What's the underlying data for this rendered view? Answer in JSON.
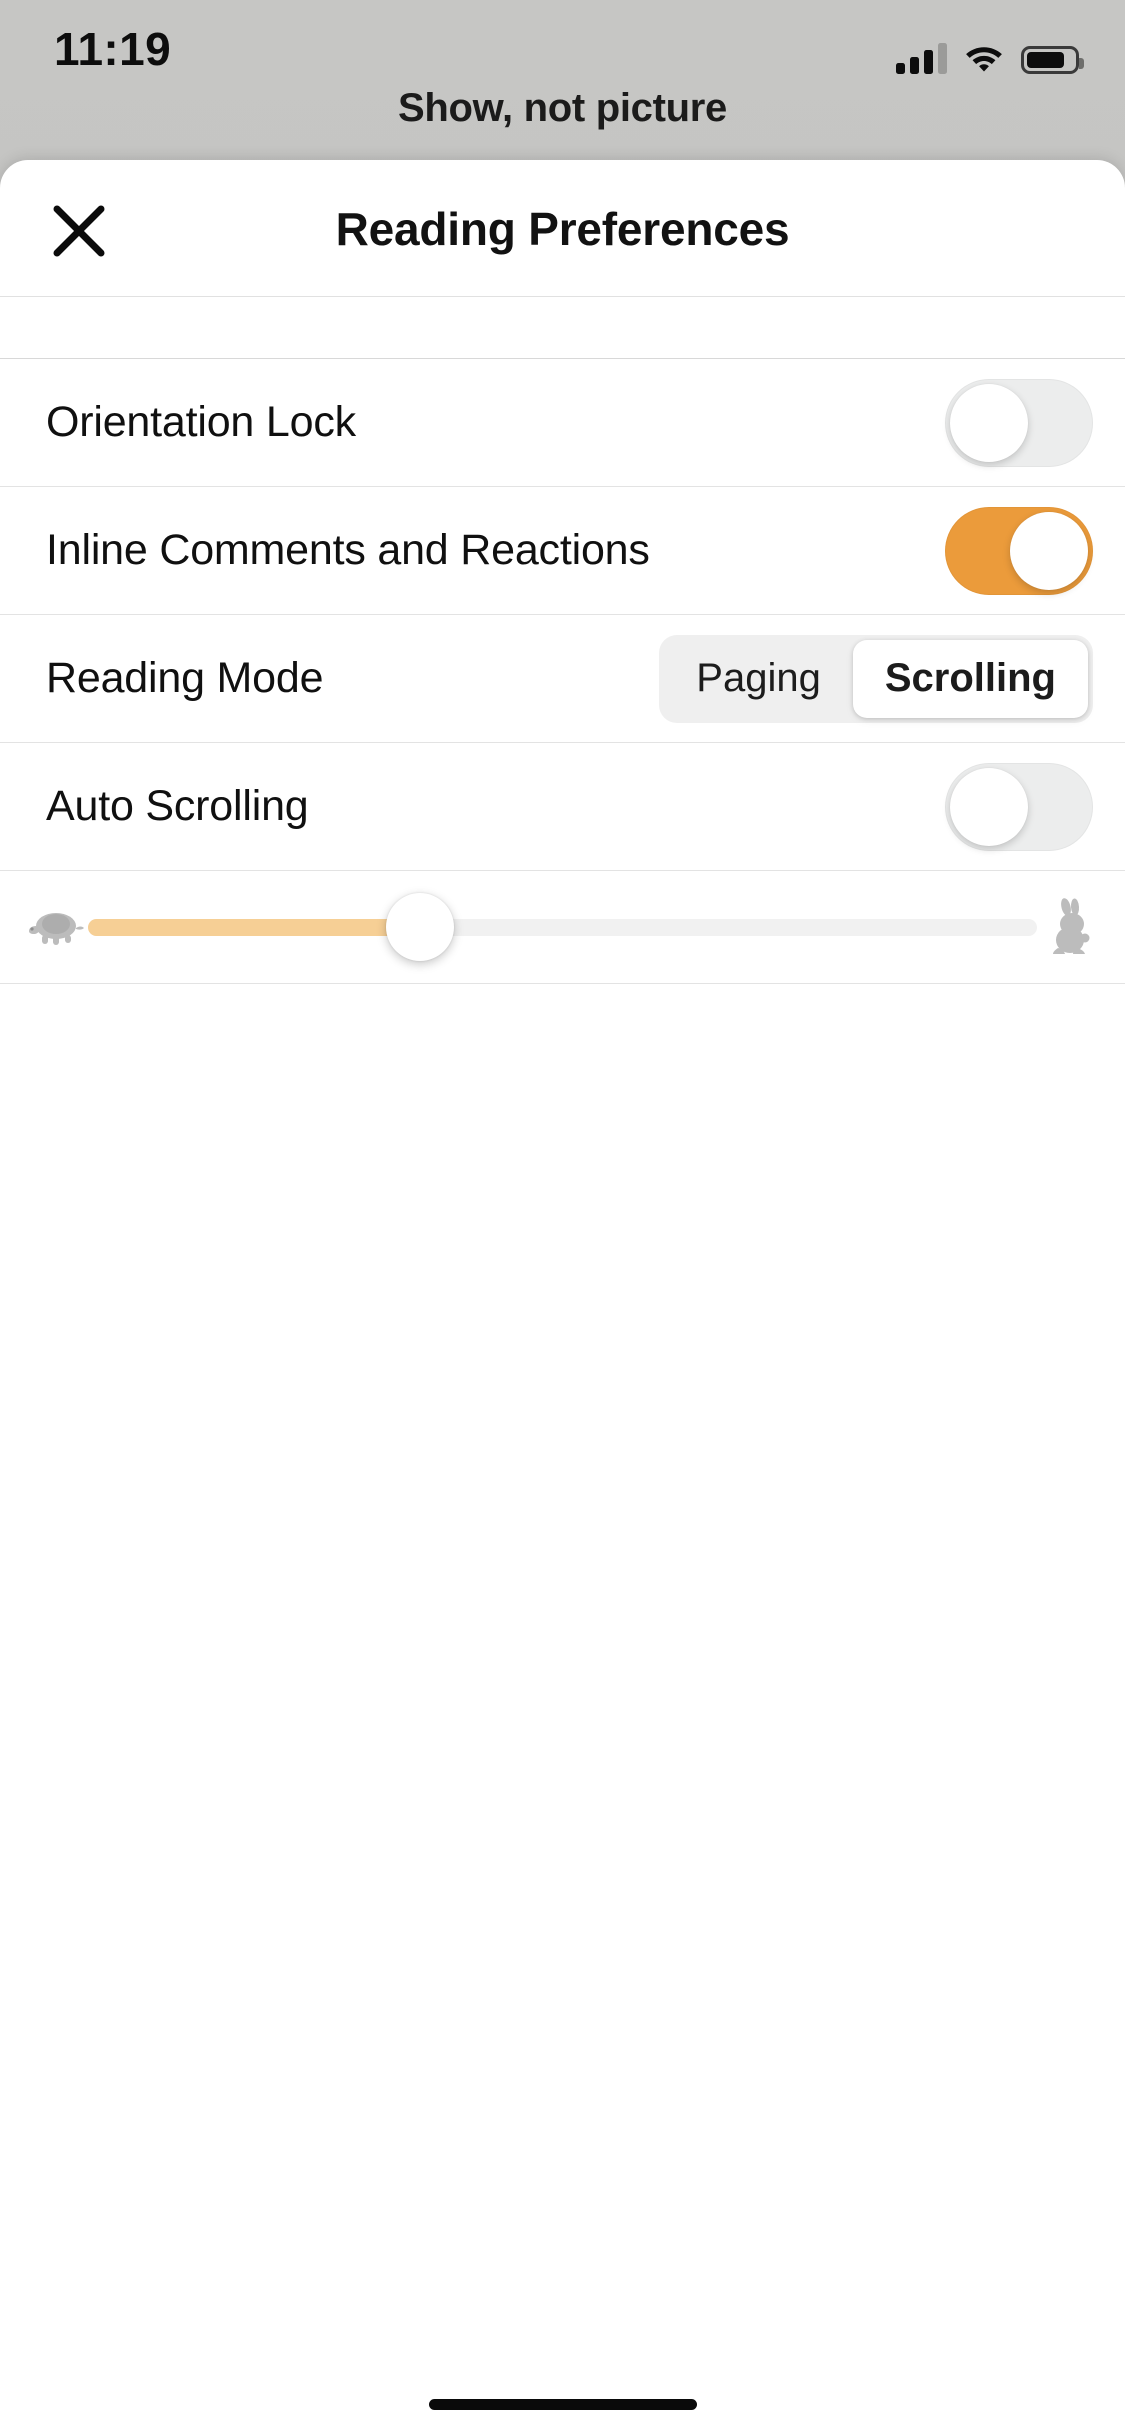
{
  "status_bar": {
    "time": "11:19",
    "signal_icon": "cellular-signal-icon",
    "signal_bars_total": 4,
    "signal_bars_active": 3,
    "wifi_icon": "wifi-icon",
    "battery_icon": "battery-icon",
    "battery_fill_percent": 80
  },
  "background_screen": {
    "title": "Show, not picture"
  },
  "sheet": {
    "close_icon": "close-icon",
    "title": "Reading Preferences"
  },
  "settings": {
    "rows": [
      {
        "label": "Orientation Lock",
        "control": "toggle",
        "value": "off",
        "name": "orientation-lock"
      },
      {
        "label": "Inline Comments and Reactions",
        "control": "toggle",
        "value": "on",
        "name": "inline-comments-and-reactions"
      },
      {
        "label": "Reading Mode",
        "control": "segmented",
        "options": [
          "Paging",
          "Scrolling"
        ],
        "selected": "Scrolling",
        "name": "reading-mode"
      },
      {
        "label": "Auto Scrolling",
        "control": "toggle",
        "value": "off",
        "name": "auto-scrolling"
      }
    ],
    "speed_slider": {
      "name": "auto-scrolling-speed-slider",
      "min_icon": "turtle-icon",
      "max_icon": "rabbit-icon",
      "value_percent": 35
    }
  },
  "colors": {
    "accent_orange": "#eb9b3b",
    "slider_fill": "#f6cf95",
    "toggle_off_track": "#eceded",
    "segmented_background": "#efefef",
    "sheet_background": "#ffffff",
    "backdrop": "#c2c2c0",
    "divider": "#e3e3e3",
    "text_primary": "#101010"
  }
}
